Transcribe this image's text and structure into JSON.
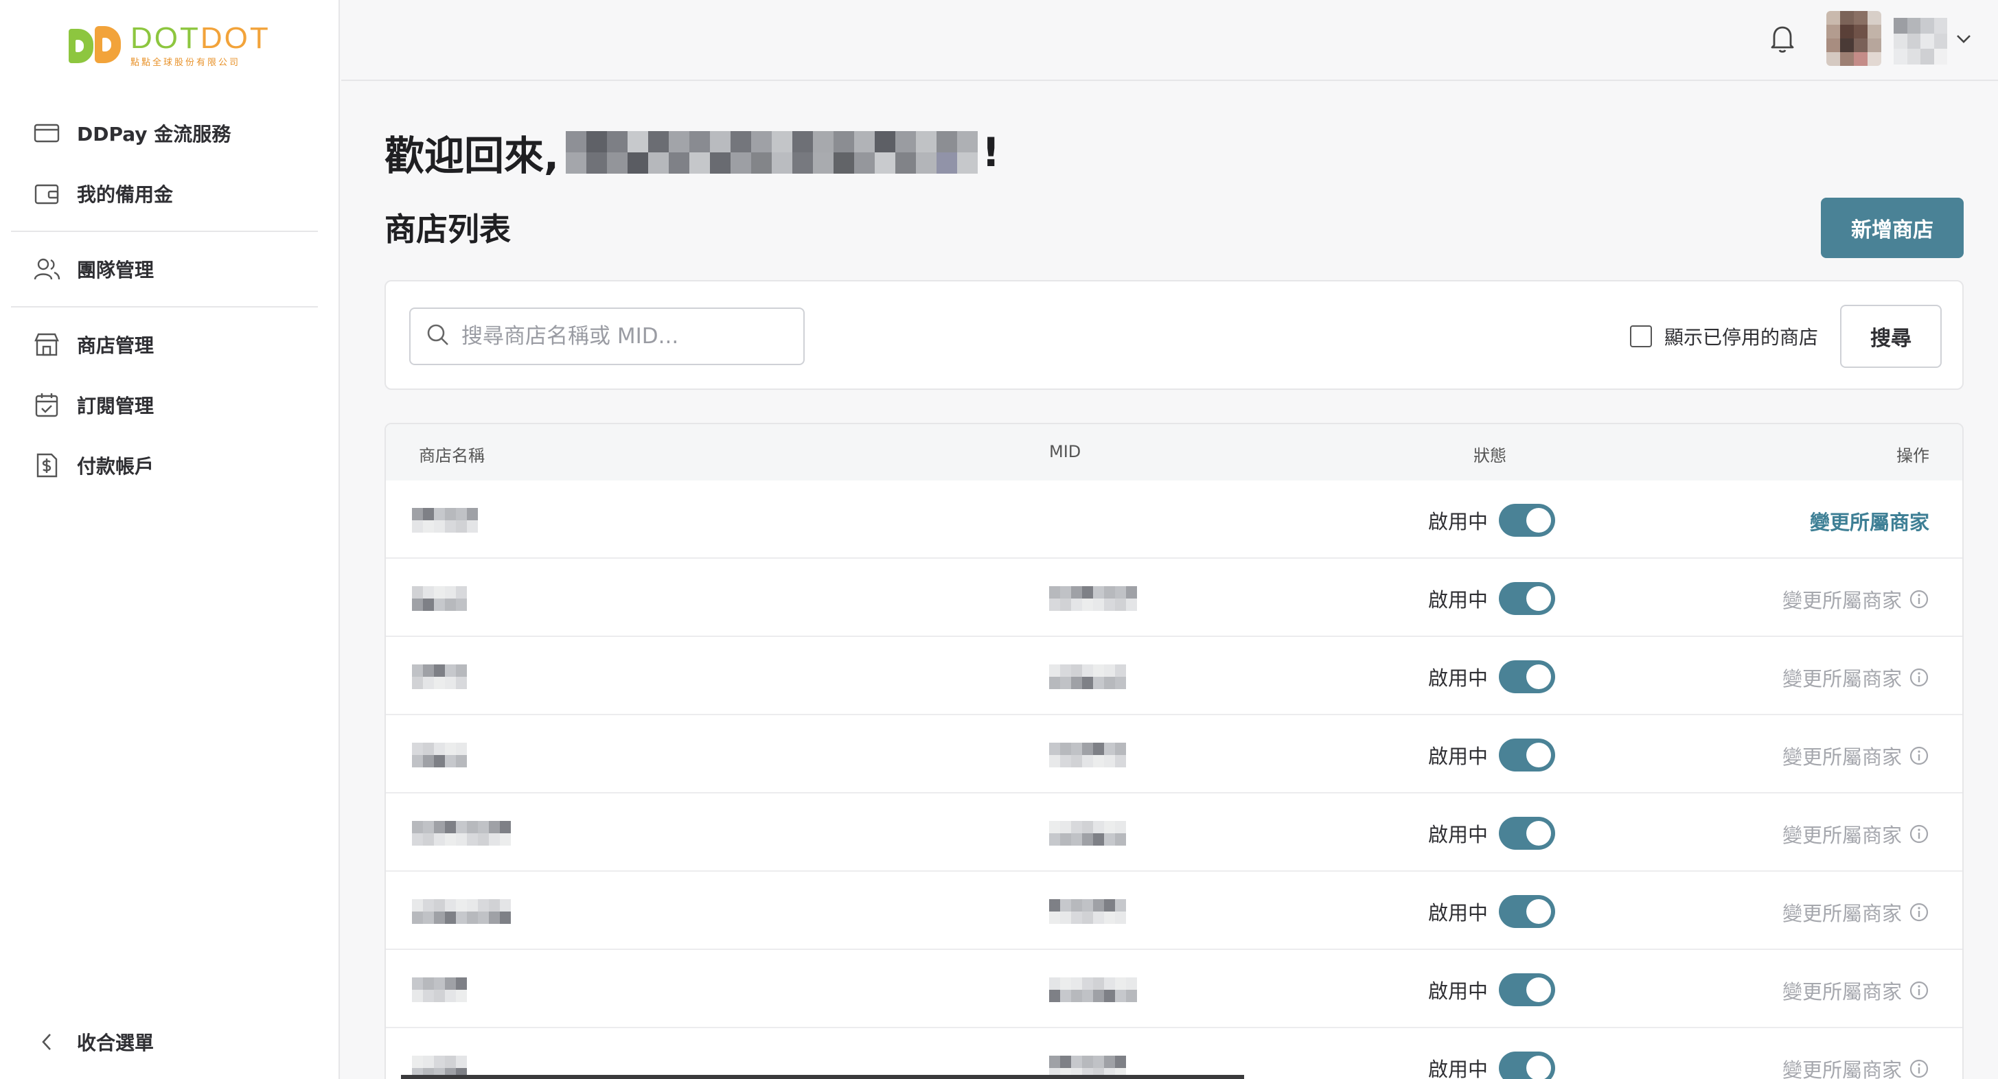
{
  "brand": {
    "name_a": "DOT",
    "name_b": "DOT",
    "subtitle": "點點全球股份有限公司"
  },
  "sidebar": {
    "items": [
      {
        "label": "DDPay 金流服務",
        "icon": "card-icon"
      },
      {
        "label": "我的備用金",
        "icon": "wallet-icon"
      },
      {
        "label": "團隊管理",
        "icon": "team-icon"
      },
      {
        "label": "商店管理",
        "icon": "store-icon"
      },
      {
        "label": "訂閱管理",
        "icon": "calendar-check-icon"
      },
      {
        "label": "付款帳戶",
        "icon": "dollar-doc-icon"
      }
    ],
    "collapse_label": "收合選單"
  },
  "header": {
    "welcome_prefix": "歡迎回來,",
    "welcome_suffix": "!"
  },
  "page": {
    "section_title": "商店列表",
    "add_store_label": "新增商店"
  },
  "search": {
    "placeholder": "搜尋商店名稱或 MID...",
    "value": "",
    "show_disabled_label": "顯示已停用的商店",
    "show_disabled_checked": false,
    "button_label": "搜尋"
  },
  "table": {
    "columns": [
      "商店名稱",
      "MID",
      "狀態",
      "操作"
    ],
    "rows": [
      {
        "status": "啟用中",
        "enabled": true,
        "action": "變更所屬商家",
        "action_enabled": true
      },
      {
        "status": "啟用中",
        "enabled": true,
        "action": "變更所屬商家",
        "action_enabled": false
      },
      {
        "status": "啟用中",
        "enabled": true,
        "action": "變更所屬商家",
        "action_enabled": false
      },
      {
        "status": "啟用中",
        "enabled": true,
        "action": "變更所屬商家",
        "action_enabled": false
      },
      {
        "status": "啟用中",
        "enabled": true,
        "action": "變更所屬商家",
        "action_enabled": false
      },
      {
        "status": "啟用中",
        "enabled": true,
        "action": "變更所屬商家",
        "action_enabled": false
      },
      {
        "status": "啟用中",
        "enabled": true,
        "action": "變更所屬商家",
        "action_enabled": false
      },
      {
        "status": "啟用中",
        "enabled": true,
        "action": "變更所屬商家",
        "action_enabled": false
      }
    ]
  },
  "colors": {
    "accent": "#4a8296",
    "action_link": "#3e7f95",
    "muted": "#a5a7ad",
    "brand_green": "#8dc63f",
    "brand_orange": "#f2a33a"
  }
}
